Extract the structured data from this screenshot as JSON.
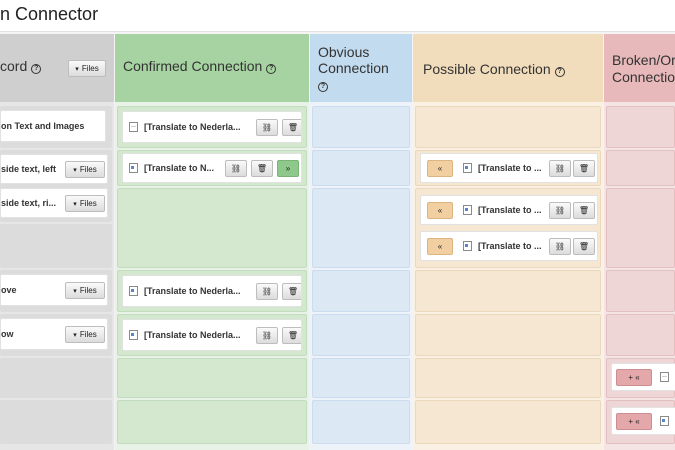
{
  "title": "n Connector",
  "columns": {
    "record": "cord",
    "confirmed": "Confirmed Connection",
    "obvious": "Obvious Connection",
    "possible": "Possible Connection",
    "broken": "Broken/Or Connectio"
  },
  "help_glyph": "?",
  "files_label": "Files",
  "records": [
    "on Text and Images",
    "side text, left",
    "side text, ri...",
    "ove",
    "ow"
  ],
  "confirmed_items": [
    "[Translate to Nederla...",
    "[Translate to N...",
    "[Translate to Nederla...",
    "[Translate to Nederla..."
  ],
  "possible_items": [
    "[Translate to ...",
    "[Translate to ...",
    "[Translate to ..."
  ],
  "glyphs": {
    "unlink": "⛓",
    "trash": "🗑",
    "forward": "»",
    "back": "«",
    "add": "+ «",
    "dropdown": "▾"
  },
  "colors": {
    "gray_header": "#cfcfcf",
    "green_header": "#a6d3a1",
    "blue_header": "#c2dbef",
    "orange_header": "#f1dcbb",
    "red_header": "#e7b9ba",
    "accent_green": "#8fc88b",
    "accent_orange": "#f1cfa0",
    "accent_red": "#e4a8aa"
  }
}
